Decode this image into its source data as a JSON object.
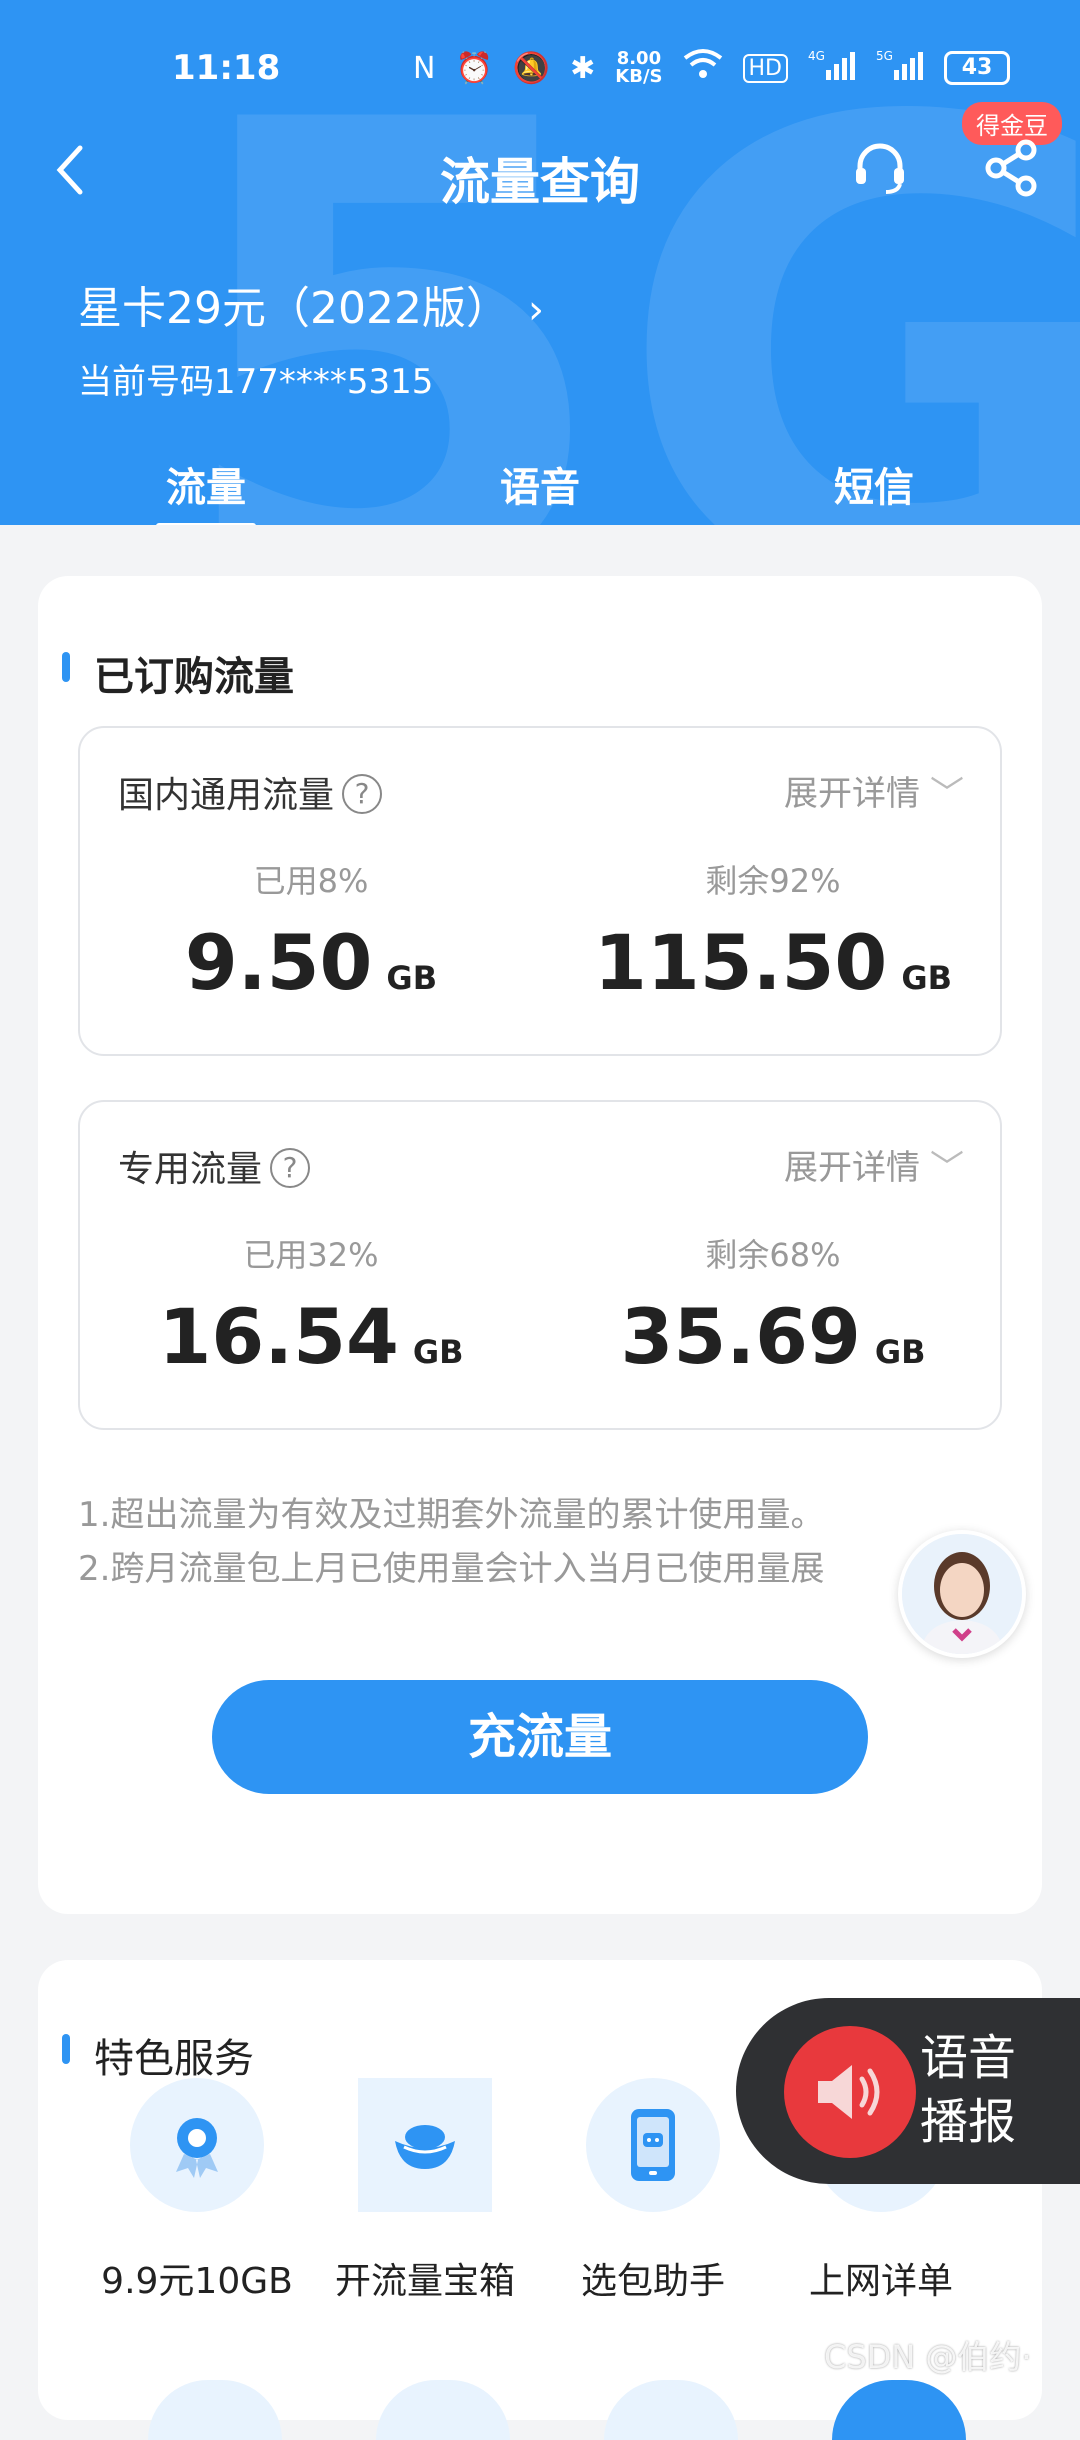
{
  "status_bar": {
    "time": "11:18",
    "net_speed_value": "8.00",
    "net_speed_unit": "KB/S",
    "battery": "43",
    "icons": [
      "nfc-icon",
      "alarm-icon",
      "mute-icon",
      "bluetooth-icon",
      "wifi-icon",
      "hd-icon",
      "signal-4g-icon",
      "signal-5g-icon",
      "battery-icon"
    ]
  },
  "header": {
    "title": "流量查询",
    "coin_badge": "得金豆",
    "plan_name": "星卡29元（2022版）",
    "phone_number": "当前号码177****5315"
  },
  "tabs": [
    {
      "label": "流量",
      "active": true
    },
    {
      "label": "语音",
      "active": false
    },
    {
      "label": "短信",
      "active": false
    }
  ],
  "subscribed": {
    "section_title": "已订购流量",
    "boxes": [
      {
        "title": "国内通用流量",
        "expand_label": "展开详情",
        "used_label": "已用8%",
        "used_value": "9.50",
        "remain_label": "剩余92%",
        "remain_value": "115.50",
        "unit": "GB"
      },
      {
        "title": "专用流量",
        "expand_label": "展开详情",
        "used_label": "已用32%",
        "used_value": "16.54",
        "remain_label": "剩余68%",
        "remain_value": "35.69",
        "unit": "GB"
      }
    ],
    "notes": [
      "1.超出流量为有效及过期套外流量的累计使用量。",
      "2.跨月流量包上月已使用量会计入当月已使用量展"
    ],
    "cta_label": "充流量"
  },
  "services": {
    "section_title": "特色服务",
    "items": [
      {
        "label": "9.9元10GB",
        "icon": "award-icon"
      },
      {
        "label": "开流量宝箱",
        "icon": "ingot-icon"
      },
      {
        "label": "选包助手",
        "icon": "robot-phone-icon"
      },
      {
        "label": "上网详单",
        "icon": "bill-icon"
      }
    ]
  },
  "voice_broadcast": {
    "label_line1": "语音",
    "label_line2": "播报"
  },
  "watermark": "CSDN @伯约·",
  "colors": {
    "primary": "#2e94f3",
    "voice_red": "#e8393d",
    "badge_red": "#ff5a5a"
  }
}
